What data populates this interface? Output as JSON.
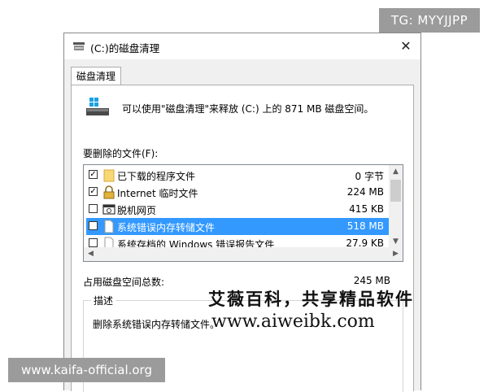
{
  "overlays": {
    "tg_badge": "TG: MYYJJPP",
    "site_badge": "www.kaifa-official.org",
    "watermark_line1": "艾薇百科，共享精品软件",
    "watermark_line2": "www.aiweibk.com"
  },
  "window": {
    "title": "(C:)的磁盘清理",
    "close_glyph": "✕",
    "tab_label": "磁盘清理",
    "header_message": "可以使用\"磁盘清理\"来释放 (C:) 上的 871 MB 磁盘空间。",
    "files_label": "要删除的文件(F):",
    "files": [
      {
        "name": "已下载的程序文件",
        "size": "0 字节",
        "checked": true,
        "icon": "folder-icon",
        "selected": false
      },
      {
        "name": "Internet 临时文件",
        "size": "224 MB",
        "checked": true,
        "icon": "lock-icon",
        "selected": false
      },
      {
        "name": "脱机网页",
        "size": "415 KB",
        "checked": false,
        "icon": "offline-page-icon",
        "selected": false
      },
      {
        "name": "系统错误内存转储文件",
        "size": "518 MB",
        "checked": false,
        "icon": "file-icon",
        "selected": true
      },
      {
        "name": "系统存档的 Windows 错误报告文件",
        "size": "27.9 KB",
        "checked": false,
        "icon": "file-icon",
        "selected": false
      }
    ],
    "total_label": "占用磁盘空间总数:",
    "total_value": "245 MB",
    "description_legend": "描述",
    "description_text": "删除系统错误内存转储文件。"
  },
  "colors": {
    "selection": "#3399ff",
    "badge_bg": "#9b9b9b",
    "dialog_bg": "#f0f0f0"
  }
}
